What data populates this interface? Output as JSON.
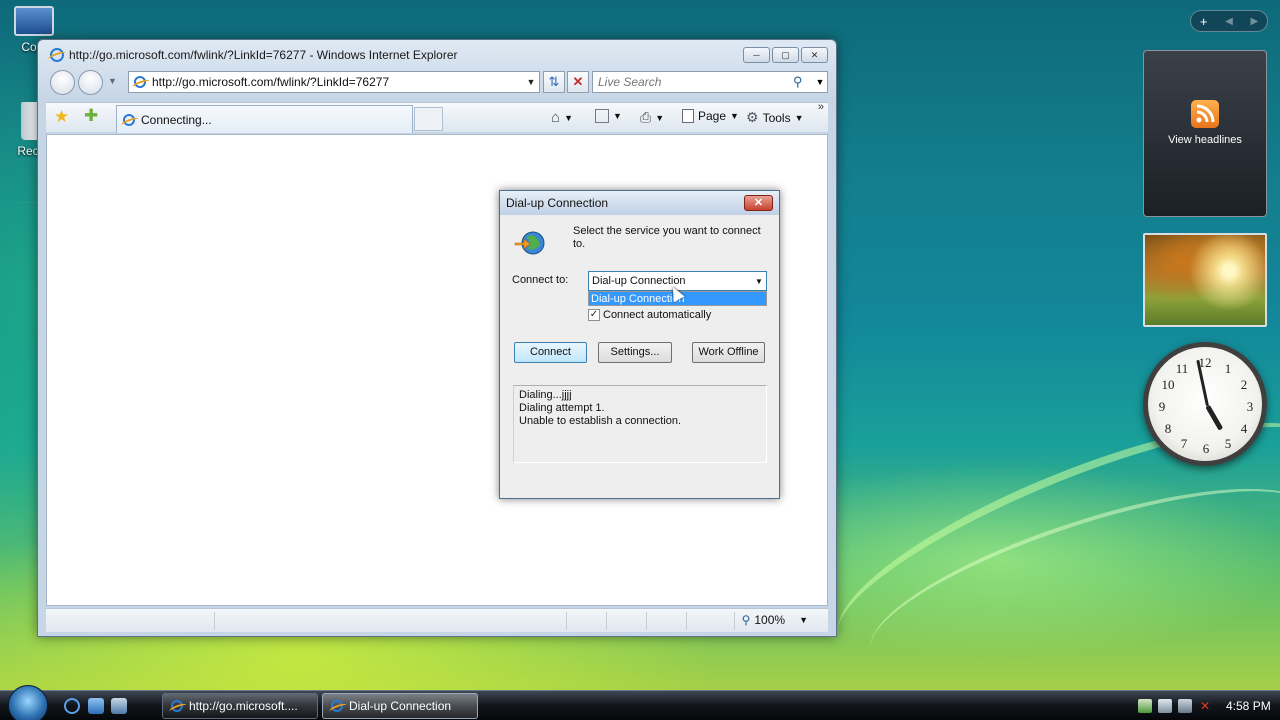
{
  "desktop": {
    "icons": [
      {
        "label": "Com"
      },
      {
        "label": "Recyc"
      }
    ]
  },
  "ie": {
    "window_title": "http://go.microsoft.com/fwlink/?LinkId=76277 - Windows Internet Explorer",
    "address": "http://go.microsoft.com/fwlink/?LinkId=76277",
    "search_placeholder": "Live Search",
    "tab_label": "Connecting...",
    "toolbar": {
      "page_label": "Page",
      "tools_label": "Tools"
    },
    "zoom": "100%"
  },
  "dialog": {
    "title": "Dial-up Connection",
    "prompt": "Select the service you want to connect to.",
    "connect_to_label": "Connect to:",
    "selected_service": "Dial-up Connection",
    "dropdown_options": [
      "Dial-up Connection"
    ],
    "connect_automatically_label": "Connect automatically",
    "connect_automatically_checked": true,
    "buttons": {
      "connect": "Connect",
      "settings": "Settings...",
      "work_offline": "Work Offline"
    },
    "log_lines": [
      "Dialing...jjjj",
      "Dialing attempt 1.",
      "Unable to establish a connection."
    ]
  },
  "gadgets": {
    "feed_label": "View headlines",
    "clock_numbers": [
      "12",
      "1",
      "2",
      "3",
      "4",
      "5",
      "6",
      "7",
      "8",
      "9",
      "10",
      "11"
    ]
  },
  "taskbar": {
    "buttons": [
      {
        "label": "http://go.microsoft...."
      },
      {
        "label": "Dial-up Connection"
      }
    ],
    "time": "4:58 PM"
  }
}
